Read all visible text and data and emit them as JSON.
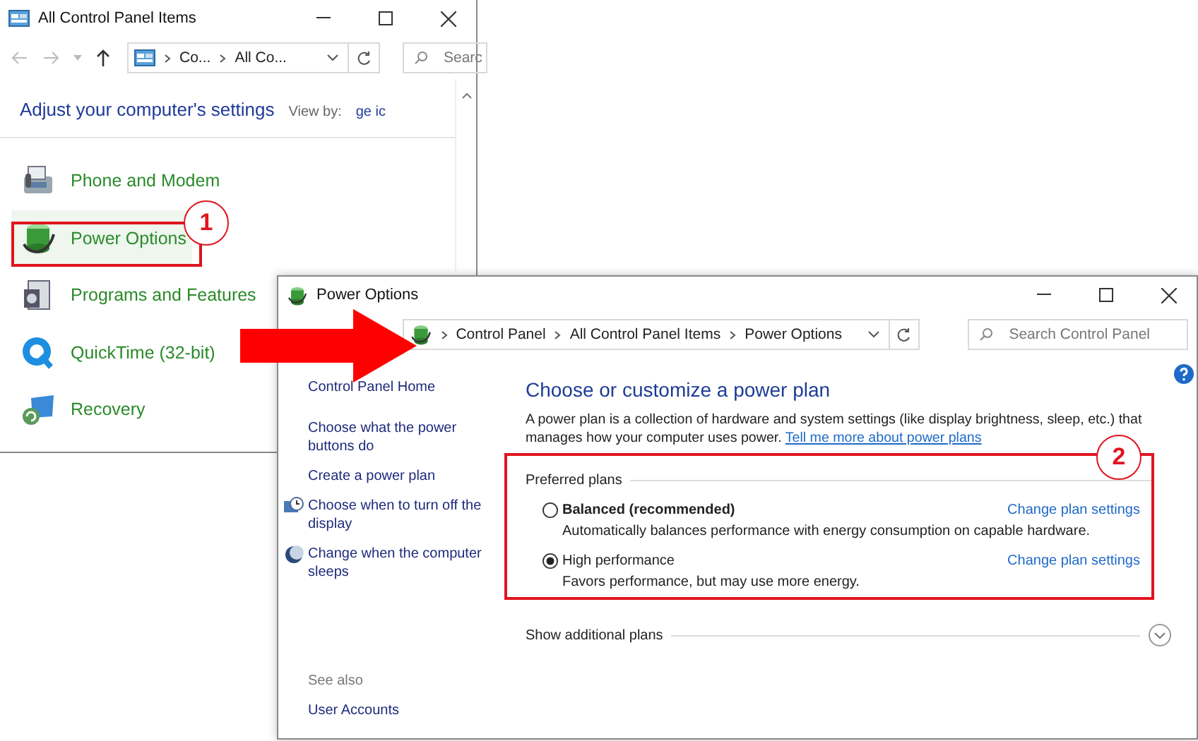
{
  "back_window": {
    "title": "All Control Panel Items",
    "breadcrumbs": [
      "Co...",
      "All Co..."
    ],
    "search": {
      "placeholder": "Searc"
    },
    "heading": "Adjust your computer's settings",
    "view_by_label": "View by:",
    "view_by_value": "ge ic",
    "items": [
      {
        "label": "Phone and Modem",
        "kind": "phone",
        "selected": false
      },
      {
        "label": "Power Options",
        "kind": "power",
        "selected": true
      },
      {
        "label": "Programs and Features",
        "kind": "programs",
        "selected": false
      },
      {
        "label": "QuickTime (32-bit)",
        "kind": "quicktime",
        "selected": false
      },
      {
        "label": "Recovery",
        "kind": "recovery",
        "selected": false
      }
    ]
  },
  "front_window": {
    "title": "Power Options",
    "breadcrumbs": [
      "Control Panel",
      "All Control Panel Items",
      "Power Options"
    ],
    "search": {
      "placeholder": "Search Control Panel"
    },
    "sidebar": {
      "links": [
        {
          "label": "Control Panel Home",
          "kind": "plain"
        },
        {
          "label": "Choose what the power buttons do",
          "kind": "plain"
        },
        {
          "label": "Create a power plan",
          "kind": "plain"
        },
        {
          "label": "Choose when to turn off the display",
          "kind": "display"
        },
        {
          "label": "Change when the computer sleeps",
          "kind": "sleep"
        }
      ],
      "see_also_label": "See also",
      "see_also_links": [
        "User Accounts"
      ]
    },
    "heading": "Choose or customize a power plan",
    "description": "A power plan is a collection of hardware and system settings (like display brightness, sleep, etc.) that manages how your computer uses power.",
    "description_link": "Tell me more about power plans",
    "group_label": "Preferred plans",
    "plans": [
      {
        "name": "Balanced (recommended)",
        "emphasized": true,
        "selected": false,
        "description": "Automatically balances performance with energy consumption on capable hardware.",
        "settings_link": "Change plan settings"
      },
      {
        "name": "High performance",
        "emphasized": false,
        "selected": true,
        "description": "Favors performance, but may use more energy.",
        "settings_link": "Change plan settings"
      }
    ],
    "show_more": "Show additional plans"
  },
  "callouts": [
    {
      "number": "1"
    },
    {
      "number": "2"
    }
  ]
}
